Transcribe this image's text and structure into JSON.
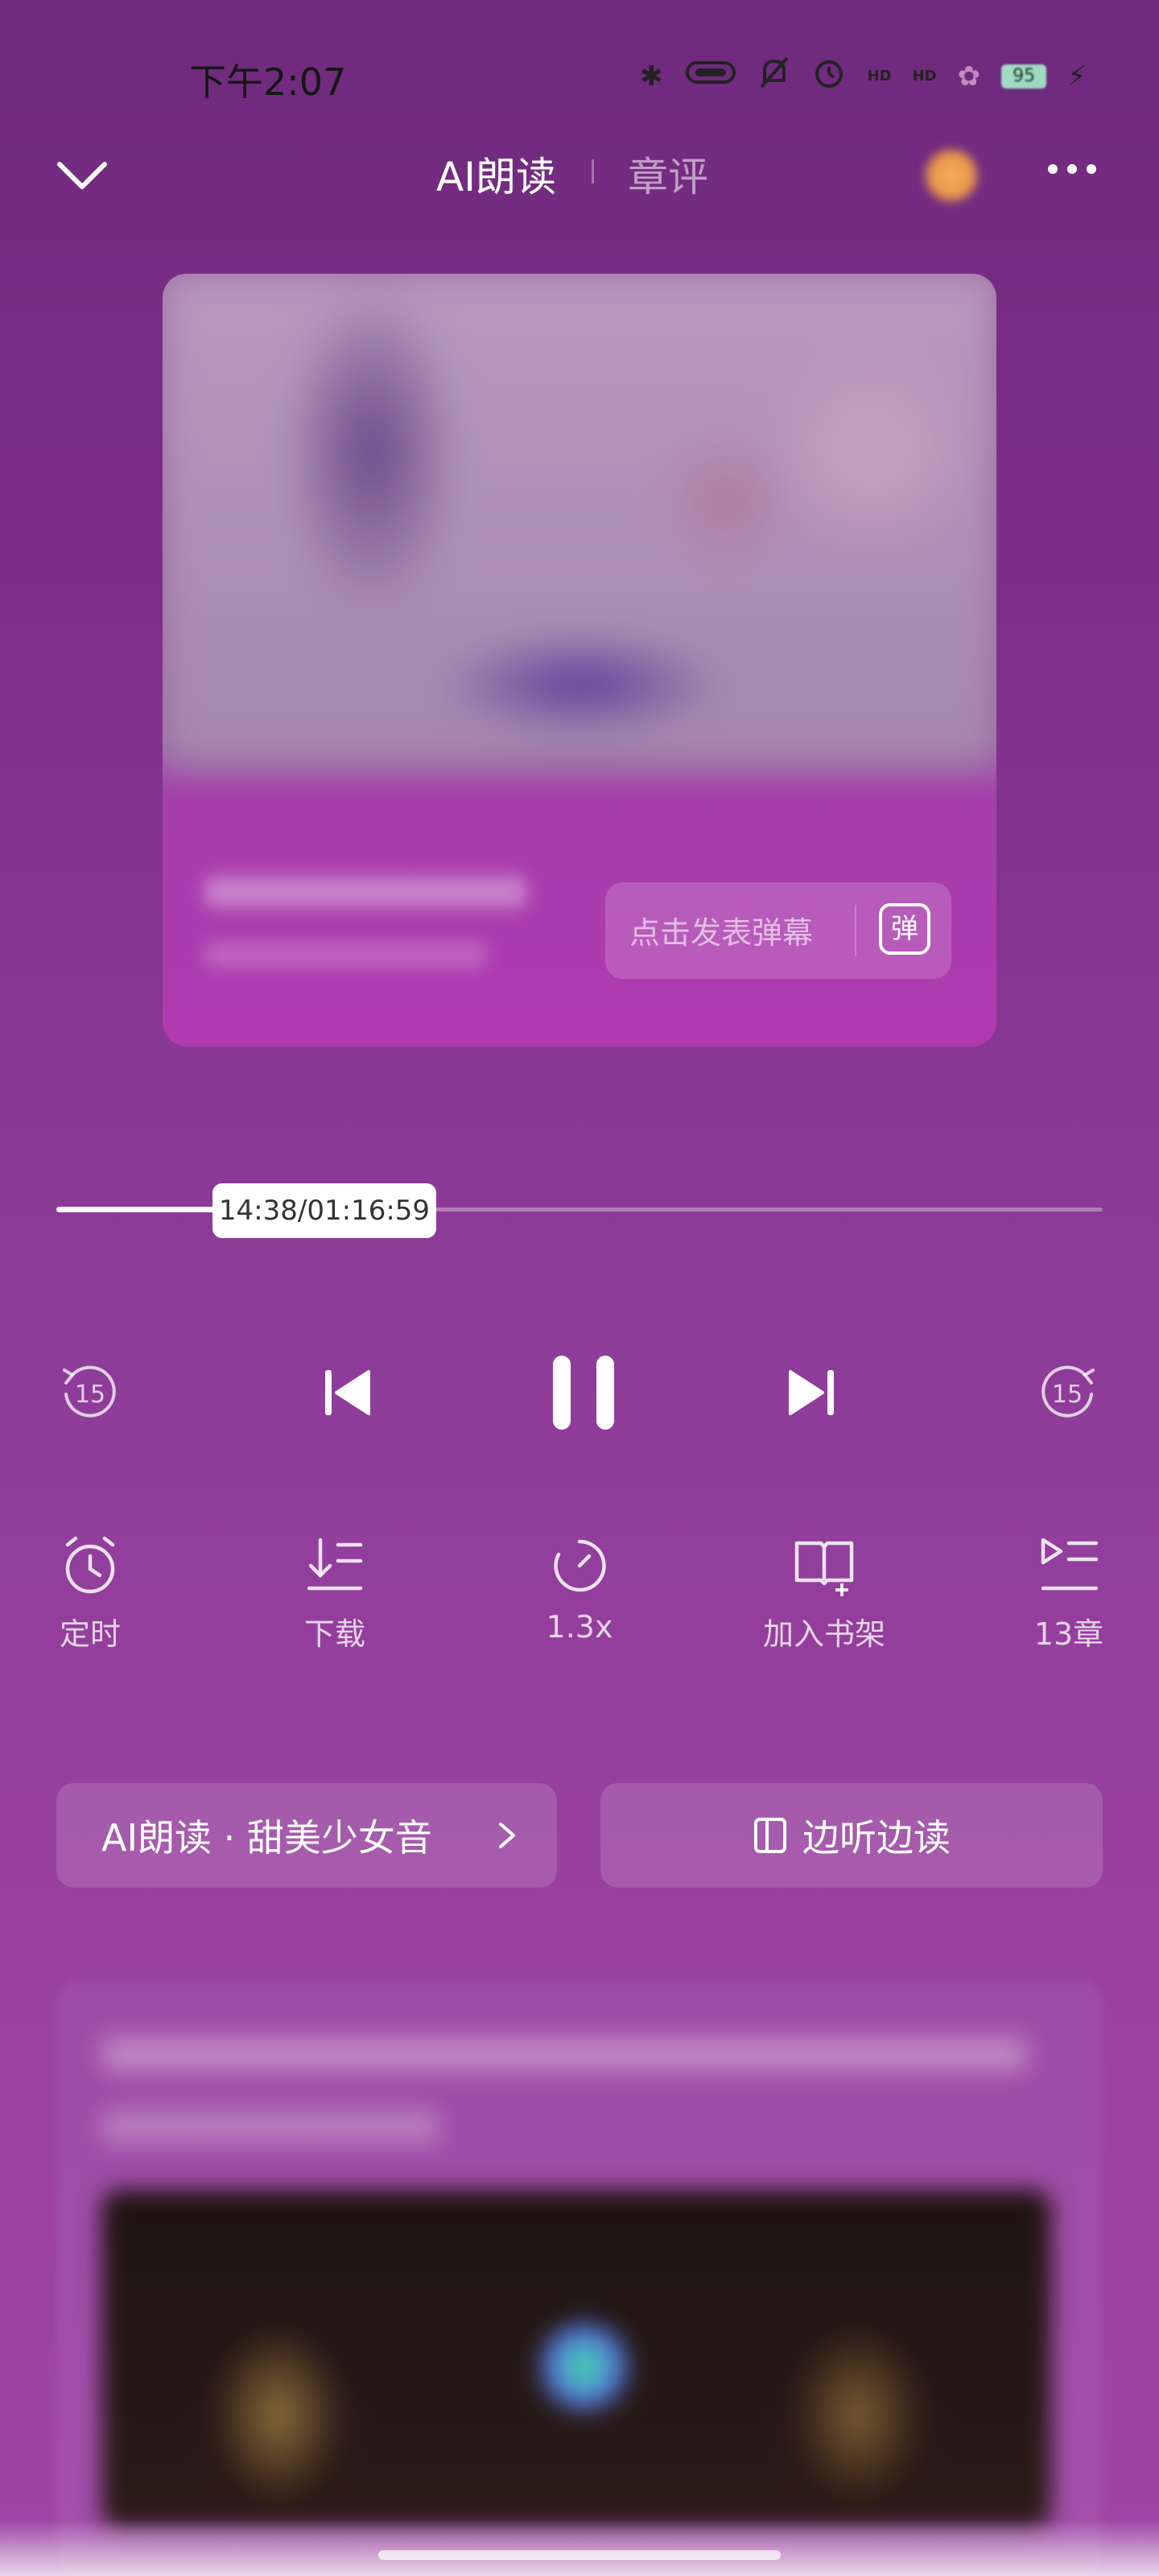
{
  "status_bar": {
    "time": "下午2:07",
    "icons": [
      "bluetooth-icon",
      "vibrate-icon",
      "mute-icon",
      "alarm-icon",
      "hd-signal-icon",
      "hd-signal-icon",
      "app-icon",
      "battery-icon",
      "charging-icon"
    ],
    "hd_label": "HD",
    "battery": "95"
  },
  "header": {
    "tab_active": "AI朗读",
    "tab_inactive": "章评"
  },
  "cover": {
    "danmaku_placeholder": "点击发表弹幕",
    "danmaku_icon_char": "弹"
  },
  "player": {
    "progress_label": "14:38/01:16:59",
    "progress_fraction": 0.19,
    "skip_seconds": "15"
  },
  "functions": [
    {
      "label": "定时",
      "icon": "timer-icon"
    },
    {
      "label": "下载",
      "icon": "download-icon"
    },
    {
      "label": "1.3x",
      "icon": "speed-icon"
    },
    {
      "label": "加入书架",
      "icon": "add-bookshelf-icon"
    },
    {
      "label": "13章",
      "icon": "chapter-list-icon"
    }
  ],
  "actions": {
    "voice_label": "AI朗读 · 甜美少女音",
    "read_along_label": "边听边读"
  }
}
